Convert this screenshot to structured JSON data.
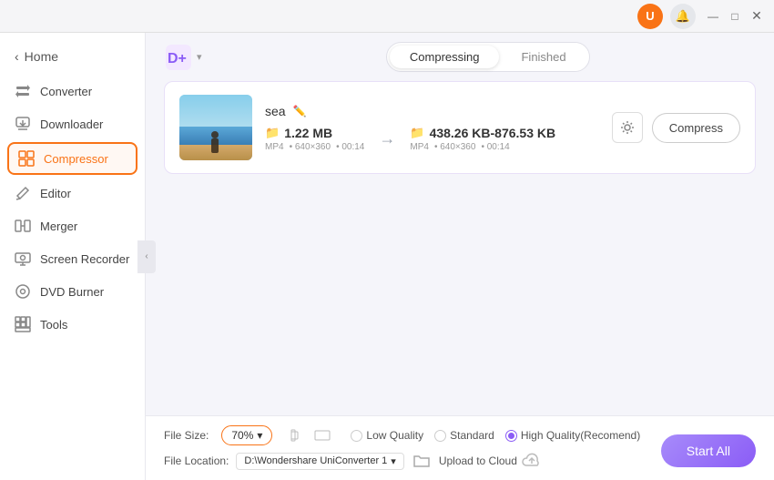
{
  "titlebar": {
    "user_icon": "U",
    "bell_icon": "🔔",
    "minimize": "—",
    "maximize": "□",
    "close": "✕"
  },
  "sidebar": {
    "back_label": "Home",
    "items": [
      {
        "id": "converter",
        "label": "Converter",
        "icon": "⇄"
      },
      {
        "id": "downloader",
        "label": "Downloader",
        "icon": "↓"
      },
      {
        "id": "compressor",
        "label": "Compressor",
        "icon": "⊞",
        "active": true
      },
      {
        "id": "editor",
        "label": "Editor",
        "icon": "✂"
      },
      {
        "id": "merger",
        "label": "Merger",
        "icon": "⊔"
      },
      {
        "id": "screen-recorder",
        "label": "Screen Recorder",
        "icon": "⏺"
      },
      {
        "id": "dvd-burner",
        "label": "DVD Burner",
        "icon": "⊙"
      },
      {
        "id": "tools",
        "label": "Tools",
        "icon": "⚙"
      }
    ],
    "collapse_icon": "‹"
  },
  "toolbar": {
    "logo_icon": "D+",
    "tabs": [
      {
        "id": "compressing",
        "label": "Compressing",
        "active": true
      },
      {
        "id": "finished",
        "label": "Finished",
        "active": false
      }
    ]
  },
  "files": [
    {
      "name": "sea",
      "original_size": "1.22 MB",
      "original_format": "MP4",
      "original_resolution": "640×360",
      "original_duration": "00:14",
      "compressed_size": "438.26 KB-876.53 KB",
      "compressed_format": "MP4",
      "compressed_resolution": "640×360",
      "compressed_duration": "00:14",
      "compress_btn": "Compress"
    }
  ],
  "bottom_bar": {
    "file_size_label": "File Size:",
    "file_size_value": "70%",
    "dropdown_arrow": "▾",
    "quality_options": [
      {
        "id": "low",
        "label": "Low Quality",
        "selected": false
      },
      {
        "id": "standard",
        "label": "Standard",
        "selected": false
      },
      {
        "id": "high",
        "label": "High Quality(Recomend)",
        "selected": true
      }
    ],
    "file_location_label": "File Location:",
    "file_location_path": "D:\\Wondershare UniConverter 1",
    "upload_cloud_label": "Upload to Cloud",
    "start_all_label": "Start All"
  }
}
